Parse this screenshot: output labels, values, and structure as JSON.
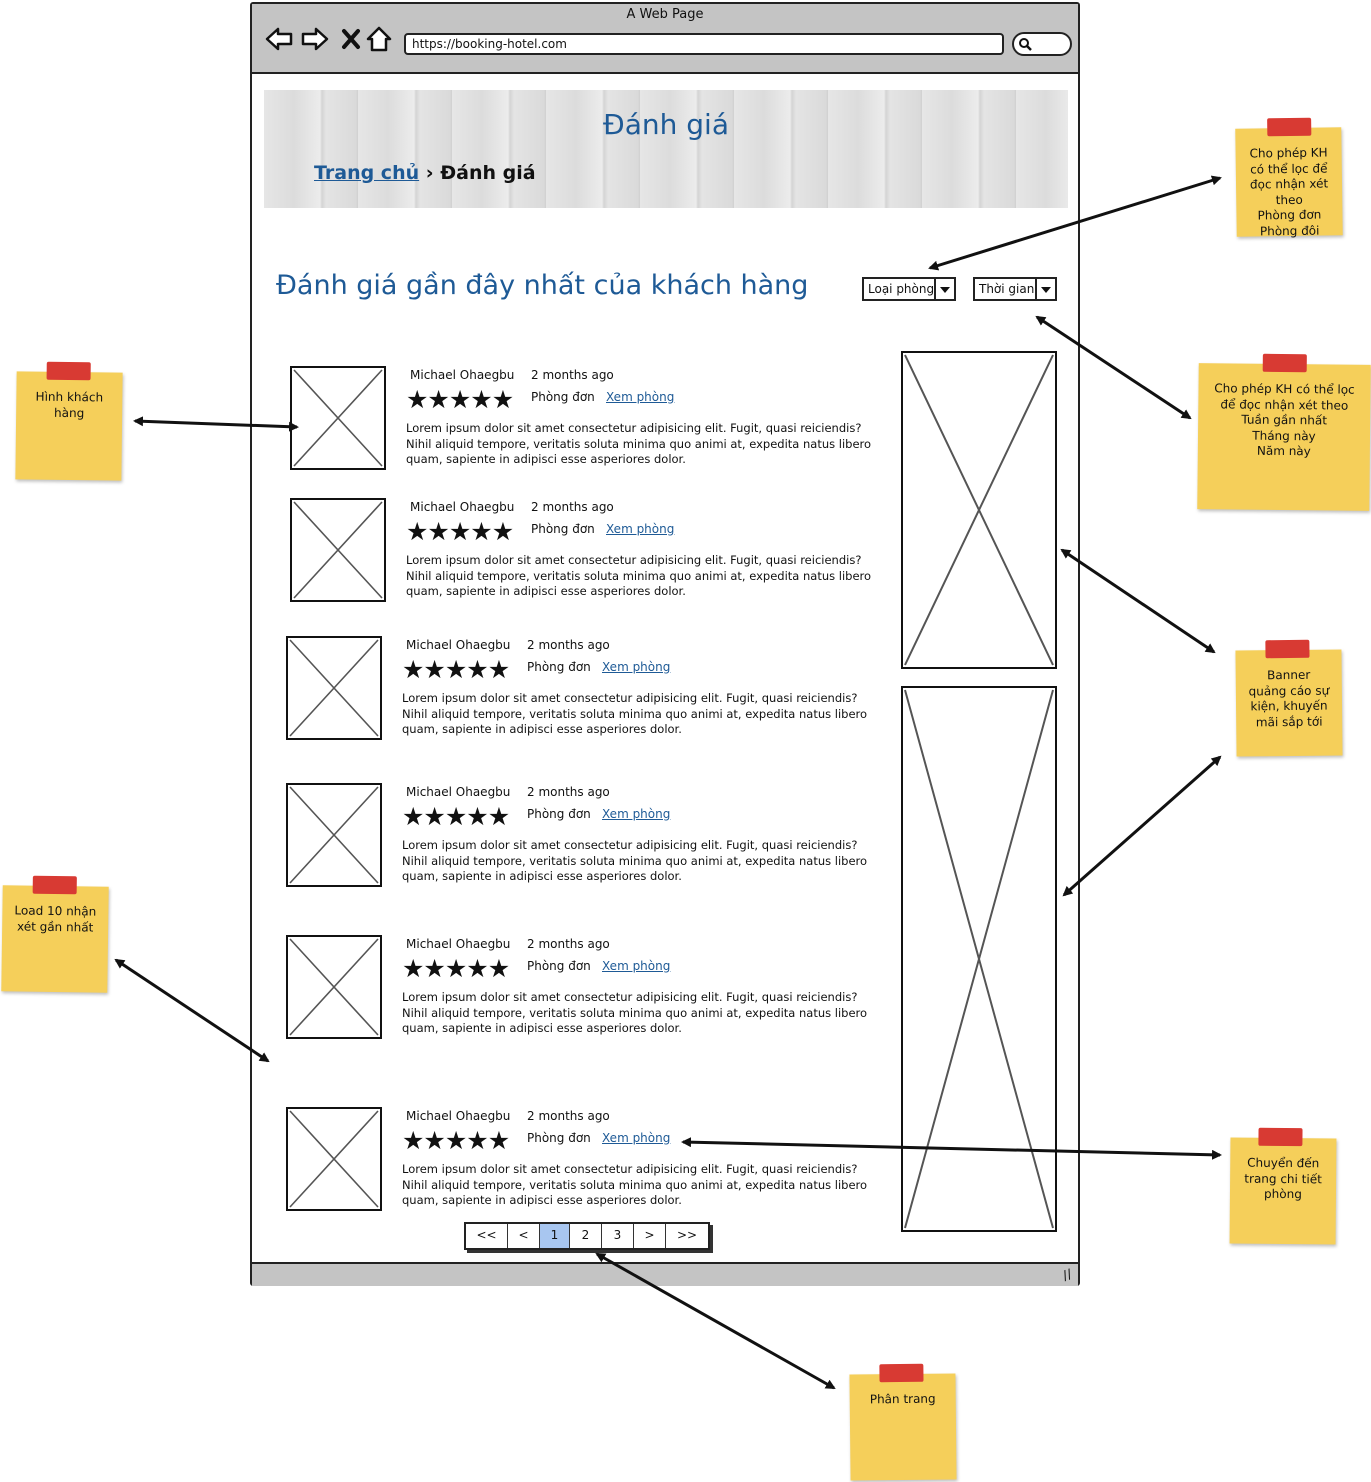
{
  "browser": {
    "window_title": "A Web Page",
    "url": "https://booking-hotel.com"
  },
  "hero": {
    "title": "Đánh giá",
    "breadcrumb_home": "Trang chủ",
    "breadcrumb_sep": "›",
    "breadcrumb_current": "Đánh giá"
  },
  "section_title": "Đánh giá gần đây nhất của khách hàng",
  "filters": {
    "room_type": "Loại phòng",
    "time": "Thời gian"
  },
  "reviews": [
    {
      "name": "Michael Ohaegbu",
      "time": "2 months ago",
      "stars": 5,
      "room": "Phòng đơn",
      "link": "Xem phòng",
      "text": "Lorem ipsum dolor sit amet consectetur adipisicing elit. Fugit, quasi reiciendis? Nihil aliquid tempore, veritatis soluta minima quo animi at, expedita natus libero quam, sapiente in adipisci esse asperiores dolor."
    },
    {
      "name": "Michael Ohaegbu",
      "time": "2 months ago",
      "stars": 5,
      "room": "Phòng đơn",
      "link": "Xem phòng",
      "text": "Lorem ipsum dolor sit amet consectetur adipisicing elit. Fugit, quasi reiciendis? Nihil aliquid tempore, veritatis soluta minima quo animi at, expedita natus libero quam, sapiente in adipisci esse asperiores dolor."
    },
    {
      "name": "Michael Ohaegbu",
      "time": "2 months ago",
      "stars": 5,
      "room": "Phòng đơn",
      "link": "Xem phòng",
      "text": "Lorem ipsum dolor sit amet consectetur adipisicing elit. Fugit, quasi reiciendis? Nihil aliquid tempore, veritatis soluta minima quo animi at, expedita natus libero quam, sapiente in adipisci esse asperiores dolor."
    },
    {
      "name": "Michael Ohaegbu",
      "time": "2 months ago",
      "stars": 5,
      "room": "Phòng đơn",
      "link": "Xem phòng",
      "text": "Lorem ipsum dolor sit amet consectetur adipisicing elit. Fugit, quasi reiciendis? Nihil aliquid tempore, veritatis soluta minima quo animi at, expedita natus libero quam, sapiente in adipisci esse asperiores dolor."
    },
    {
      "name": "Michael Ohaegbu",
      "time": "2 months ago",
      "stars": 5,
      "room": "Phòng đơn",
      "link": "Xem phòng",
      "text": "Lorem ipsum dolor sit amet consectetur adipisicing elit. Fugit, quasi reiciendis? Nihil aliquid tempore, veritatis soluta minima quo animi at, expedita natus libero quam, sapiente in adipisci esse asperiores dolor."
    },
    {
      "name": "Michael Ohaegbu",
      "time": "2 months ago",
      "stars": 5,
      "room": "Phòng đơn",
      "link": "Xem phòng",
      "text": "Lorem ipsum dolor sit amet consectetur adipisicing elit. Fugit, quasi reiciendis? Nihil aliquid tempore, veritatis soluta minima quo animi at, expedita natus libero quam, sapiente in adipisci esse asperiores dolor."
    }
  ],
  "pagination": {
    "items": [
      "<<",
      "<",
      "1",
      "2",
      "3",
      ">",
      ">>"
    ],
    "active": "1"
  },
  "notes": {
    "room_filter": "Cho phép KH có thể lọc để đọc nhận xét theo\nPhòng đơn\nPhòng đôi",
    "time_filter": "Cho phép KH có thể lọc để đọc nhận xét theo\nTuần gần nhất\nTháng này\nNăm này",
    "avatar": "Hình khách hàng",
    "load10": "Load 10 nhận xét gần nhất",
    "banner": "Banner quảng cáo sự kiện, khuyến mãi sắp tới",
    "room_detail": "Chuyển đến trang chi tiết phòng",
    "pagination": "Phân trang"
  },
  "icons": {
    "back": "back-arrow-icon",
    "forward": "forward-arrow-icon",
    "close": "close-icon",
    "home": "home-icon",
    "search": "search-icon",
    "star": "star-icon"
  },
  "colors": {
    "heading_blue": "#1e5a96",
    "sticky_yellow": "#f5cf5a",
    "tape_red": "#d83a33",
    "active_page": "#a8c6f0",
    "chrome_gray": "#c4c4c4"
  }
}
